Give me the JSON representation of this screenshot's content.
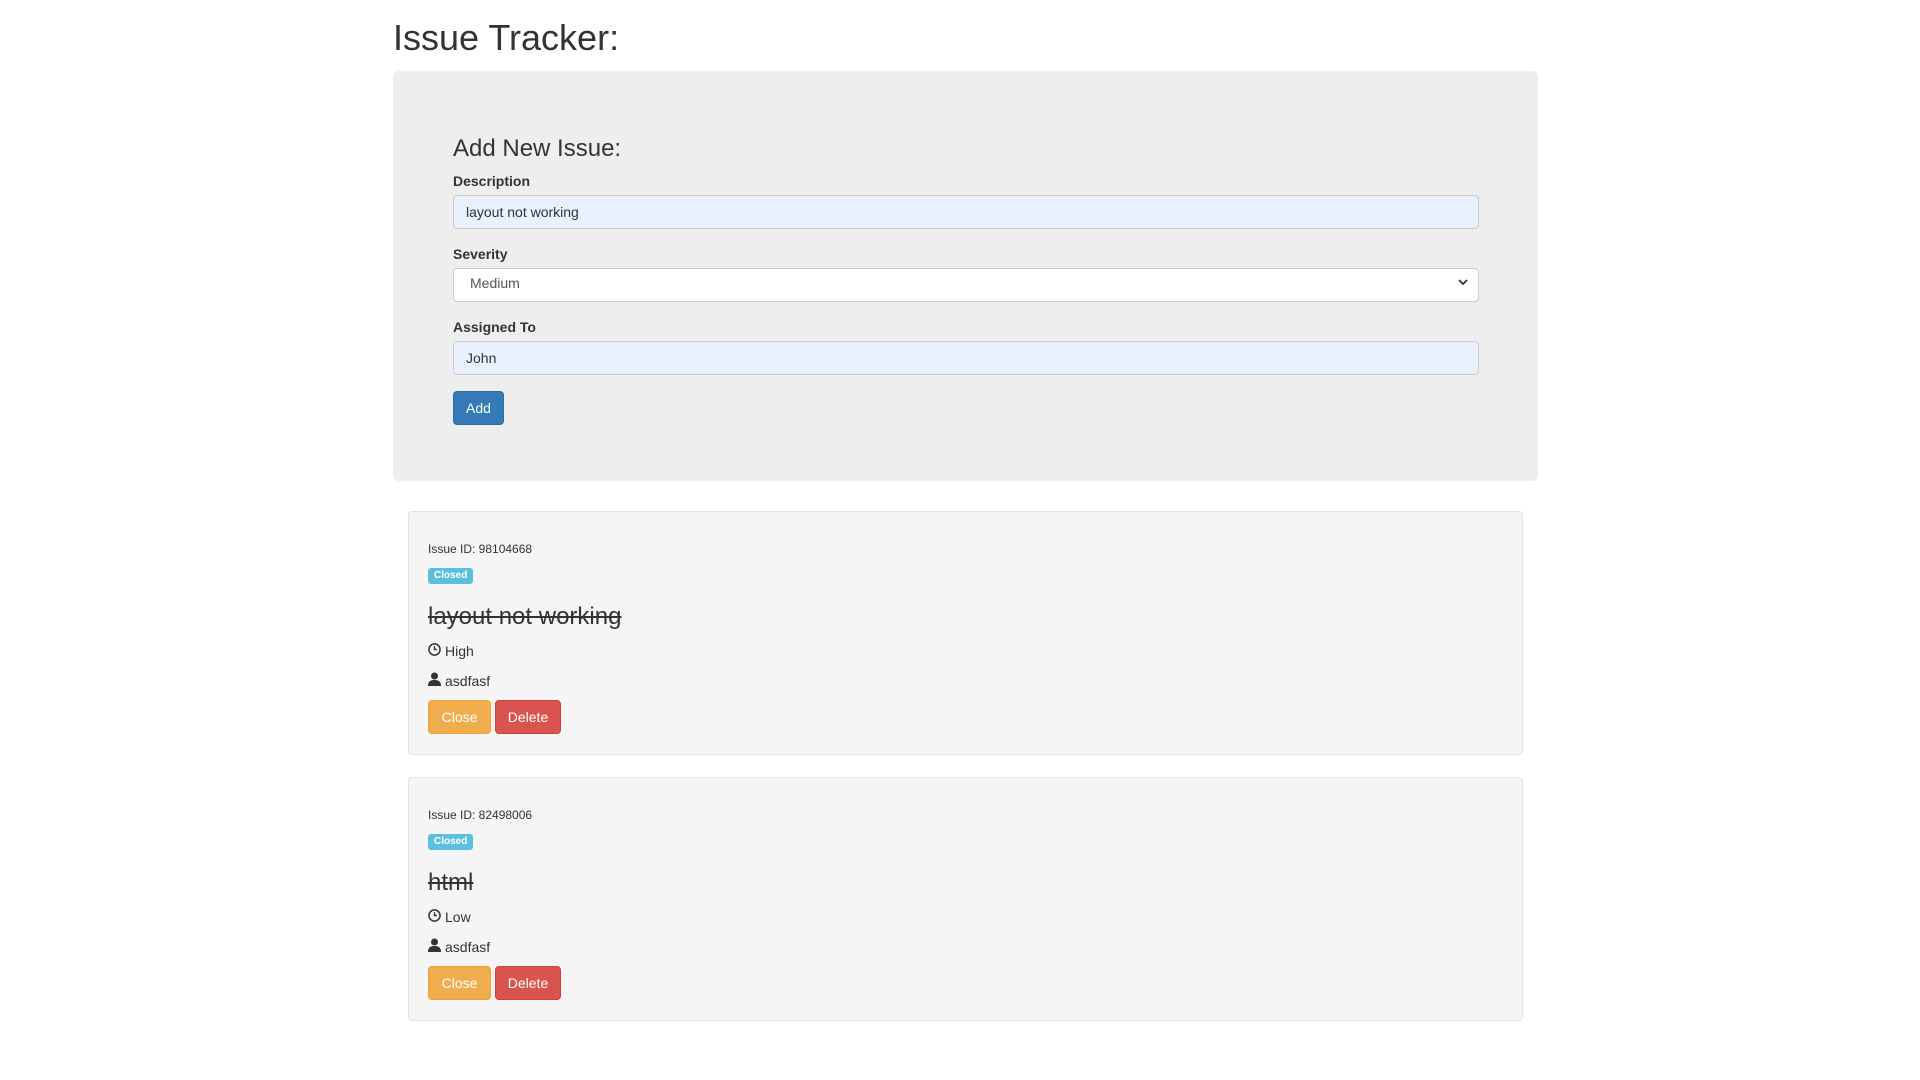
{
  "page": {
    "title": "Issue Tracker:"
  },
  "form": {
    "title": "Add New Issue:",
    "description_label": "Description",
    "description_value": "layout not working",
    "severity_label": "Severity",
    "severity_value": "Medium",
    "assigned_label": "Assigned To",
    "assigned_value": "John",
    "add_label": "Add"
  },
  "issues": [
    {
      "id_text": "Issue ID: 98104668",
      "status": "Closed",
      "description": "layout not working",
      "severity": "High",
      "assignee": "asdfasf",
      "close_label": "Close",
      "delete_label": "Delete"
    },
    {
      "id_text": "Issue ID: 82498006",
      "status": "Closed",
      "description": "html",
      "severity": "Low",
      "assignee": "asdfasf",
      "close_label": "Close",
      "delete_label": "Delete"
    }
  ],
  "icons": {
    "clock": "clock-icon",
    "user": "user-icon",
    "chevron": "chevron-down-icon"
  },
  "colors": {
    "primary": "#337ab7",
    "warning": "#f0ad4e",
    "danger": "#d9534f",
    "info": "#5bc0de"
  }
}
